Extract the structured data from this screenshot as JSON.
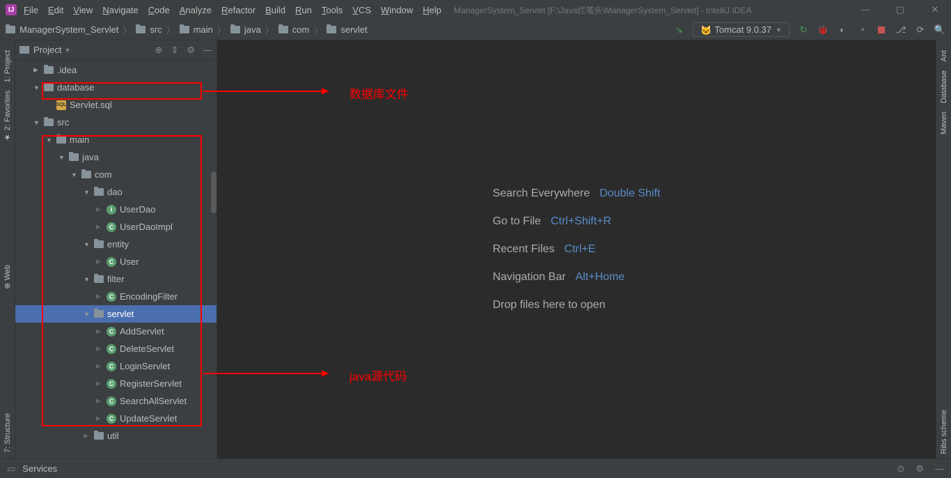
{
  "titlebar": {
    "title": "ManagerSystem_Servlet [F:\\Java烂笔头\\ManagerSystem_Servlet] - IntelliJ IDEA"
  },
  "menu": [
    "File",
    "Edit",
    "View",
    "Navigate",
    "Code",
    "Analyze",
    "Refactor",
    "Build",
    "Run",
    "Tools",
    "VCS",
    "Window",
    "Help"
  ],
  "breadcrumb": [
    "ManagerSystem_Servlet",
    "src",
    "main",
    "java",
    "com",
    "servlet"
  ],
  "run_config": "Tomcat 9.0.37",
  "panel": {
    "title": "Project"
  },
  "tree": [
    {
      "depth": 1,
      "arrow": "right",
      "icon": "folder",
      "label": ".idea"
    },
    {
      "depth": 1,
      "arrow": "down",
      "icon": "folder",
      "label": "database"
    },
    {
      "depth": 2,
      "arrow": "",
      "icon": "sql",
      "label": "Servlet.sql"
    },
    {
      "depth": 1,
      "arrow": "down",
      "icon": "folder",
      "label": "src"
    },
    {
      "depth": 2,
      "arrow": "down",
      "icon": "folder",
      "label": "main"
    },
    {
      "depth": 3,
      "arrow": "down",
      "icon": "folder",
      "label": "java"
    },
    {
      "depth": 4,
      "arrow": "down",
      "icon": "folder",
      "label": "com"
    },
    {
      "depth": 5,
      "arrow": "down",
      "icon": "folder",
      "label": "dao"
    },
    {
      "depth": 6,
      "arrow": "rightgrey",
      "icon": "interface",
      "label": "UserDao"
    },
    {
      "depth": 6,
      "arrow": "rightgrey",
      "icon": "class",
      "label": "UserDaoImpl"
    },
    {
      "depth": 5,
      "arrow": "down",
      "icon": "folder",
      "label": "entity"
    },
    {
      "depth": 6,
      "arrow": "rightgrey",
      "icon": "class",
      "label": "User"
    },
    {
      "depth": 5,
      "arrow": "down",
      "icon": "folder",
      "label": "filter"
    },
    {
      "depth": 6,
      "arrow": "rightgrey",
      "icon": "class",
      "label": "EncodingFilter"
    },
    {
      "depth": 5,
      "arrow": "down",
      "icon": "folder",
      "label": "servlet",
      "selected": true
    },
    {
      "depth": 6,
      "arrow": "rightgrey",
      "icon": "class",
      "label": "AddServlet"
    },
    {
      "depth": 6,
      "arrow": "rightgrey",
      "icon": "class",
      "label": "DeleteServlet"
    },
    {
      "depth": 6,
      "arrow": "rightgrey",
      "icon": "class",
      "label": "LoginServlet"
    },
    {
      "depth": 6,
      "arrow": "rightgrey",
      "icon": "class",
      "label": "RegisterServlet"
    },
    {
      "depth": 6,
      "arrow": "rightgrey",
      "icon": "class",
      "label": "SearchAllServlet"
    },
    {
      "depth": 6,
      "arrow": "rightgrey",
      "icon": "class",
      "label": "UpdateServlet"
    },
    {
      "depth": 5,
      "arrow": "rightgrey",
      "icon": "folder",
      "label": "util"
    }
  ],
  "welcome": [
    {
      "label": "Search Everywhere",
      "shortcut": "Double Shift"
    },
    {
      "label": "Go to File",
      "shortcut": "Ctrl+Shift+R"
    },
    {
      "label": "Recent Files",
      "shortcut": "Ctrl+E"
    },
    {
      "label": "Navigation Bar",
      "shortcut": "Alt+Home"
    },
    {
      "label": "Drop files here to open",
      "shortcut": ""
    }
  ],
  "left_rail": [
    {
      "label": "1: Project",
      "prefix": ""
    },
    {
      "label": "2: Favorites",
      "prefix": "★"
    },
    {
      "label": "Web",
      "prefix": "⊕"
    },
    {
      "label": "7: Structure",
      "prefix": ""
    }
  ],
  "right_rail": [
    "Ant",
    "Database",
    "Maven",
    "Ribs scheme"
  ],
  "status": {
    "left": "Services"
  },
  "annotations": {
    "db_label": "数据库文件",
    "java_label": "java源代码"
  }
}
